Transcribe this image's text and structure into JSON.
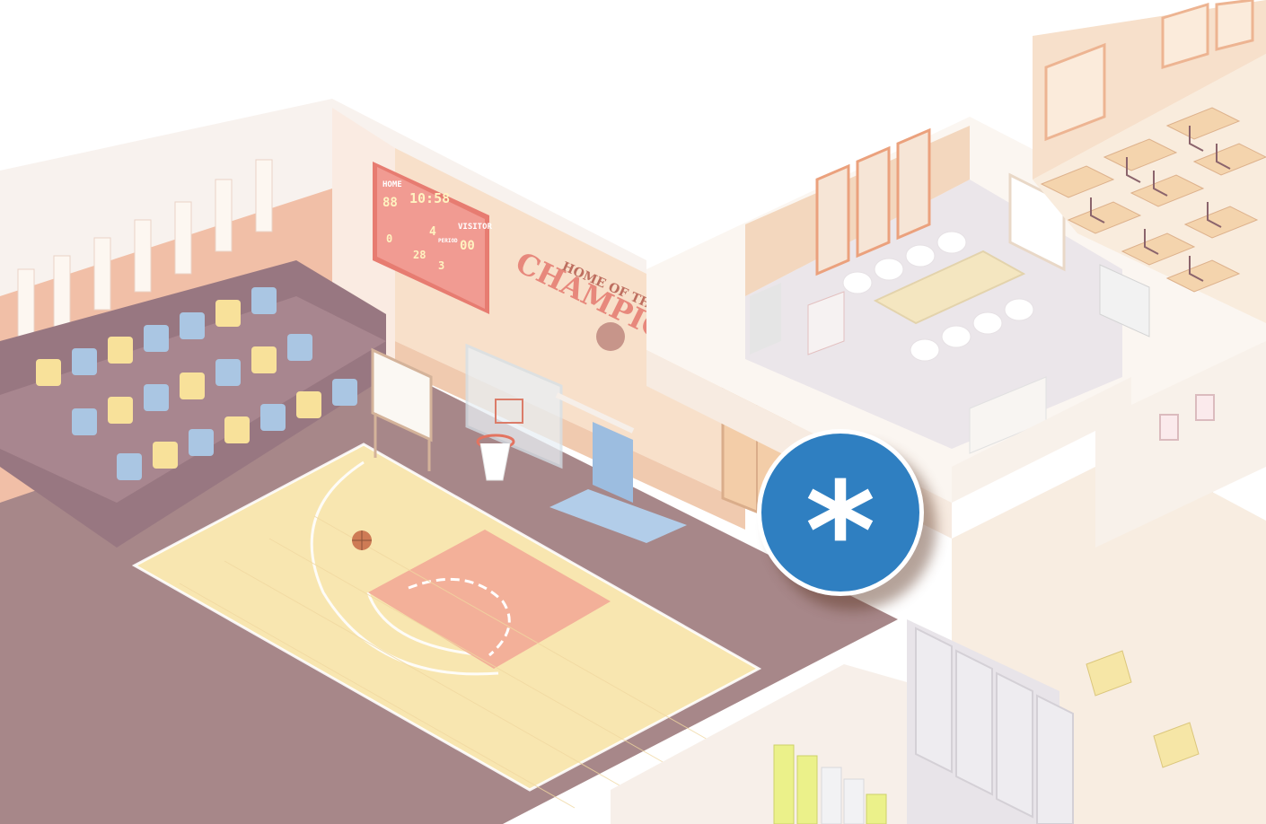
{
  "scoreboard": {
    "home_label": "HOME",
    "visitor_label": "VISITOR",
    "home_score": "88",
    "clock": "10:58",
    "period": "4",
    "period_label": "PERIOD",
    "visitor_score": "00",
    "stat_left": "0",
    "stat_mid": "28",
    "stat_right": "3"
  },
  "wall_slogan": {
    "line1": "HOME OF THE",
    "line2": "CHAMPIONS"
  },
  "hotspot": {
    "icon": "asterisk-icon",
    "glyph": "*",
    "color": "#2f7fc1"
  },
  "colors": {
    "floor": "#f8e3a6",
    "paint_area": "#f2a58b",
    "wall": "#f3c9a7",
    "bleacher_blue": "#9fbfe0",
    "bleacher_yellow": "#f7dd8c"
  }
}
